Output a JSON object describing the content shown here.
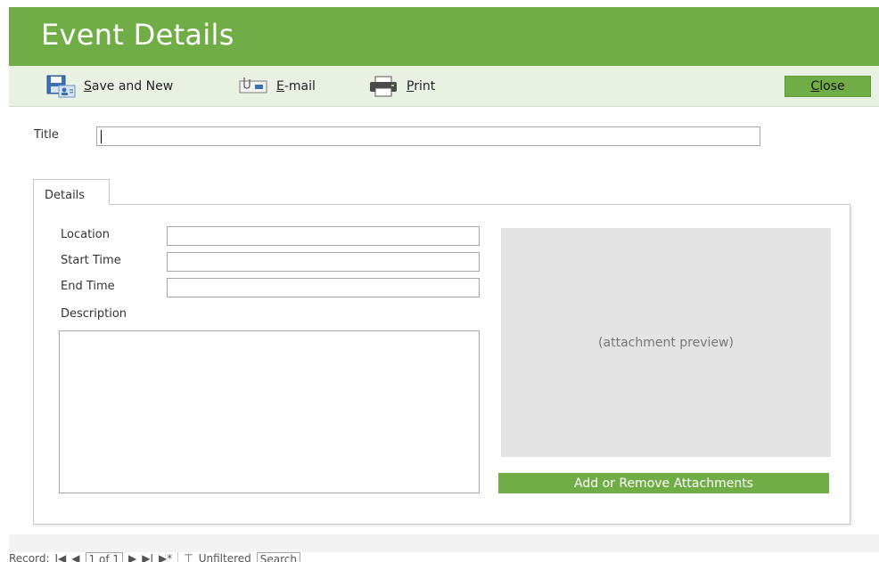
{
  "form": {
    "heading": "Event Details",
    "title_label": "Title",
    "title_value": ""
  },
  "toolbar": {
    "save_new": {
      "underline": "S",
      "rest": "ave and New",
      "icon": "save-new-icon"
    },
    "email": {
      "underline": "E",
      "rest": "-mail",
      "icon": "email-icon"
    },
    "print": {
      "underline": "P",
      "rest": "rint",
      "icon": "printer-icon"
    },
    "close": {
      "underline": "C",
      "rest": "lose"
    }
  },
  "tabs": [
    {
      "label": "Details",
      "active": true
    }
  ],
  "details": {
    "location_label": "Location",
    "location_value": "",
    "start_label": "Start Time",
    "start_value": "",
    "end_label": "End Time",
    "end_value": "",
    "description_label": "Description",
    "description_value": ""
  },
  "attachments": {
    "preview_text": "(attachment preview)",
    "button_label": "Add or Remove Attachments"
  },
  "record_nav": {
    "label": "Record:",
    "first": "I◀",
    "prev": "◀",
    "position": "1 of 1",
    "next": "▶",
    "last": "▶I",
    "new": "▶*",
    "filter": "Unfiltered",
    "search": "Search"
  },
  "colors": {
    "accent": "#70ad47",
    "toolbar_bg": "#e9f1e3",
    "preview_bg": "#e4e4e4"
  }
}
